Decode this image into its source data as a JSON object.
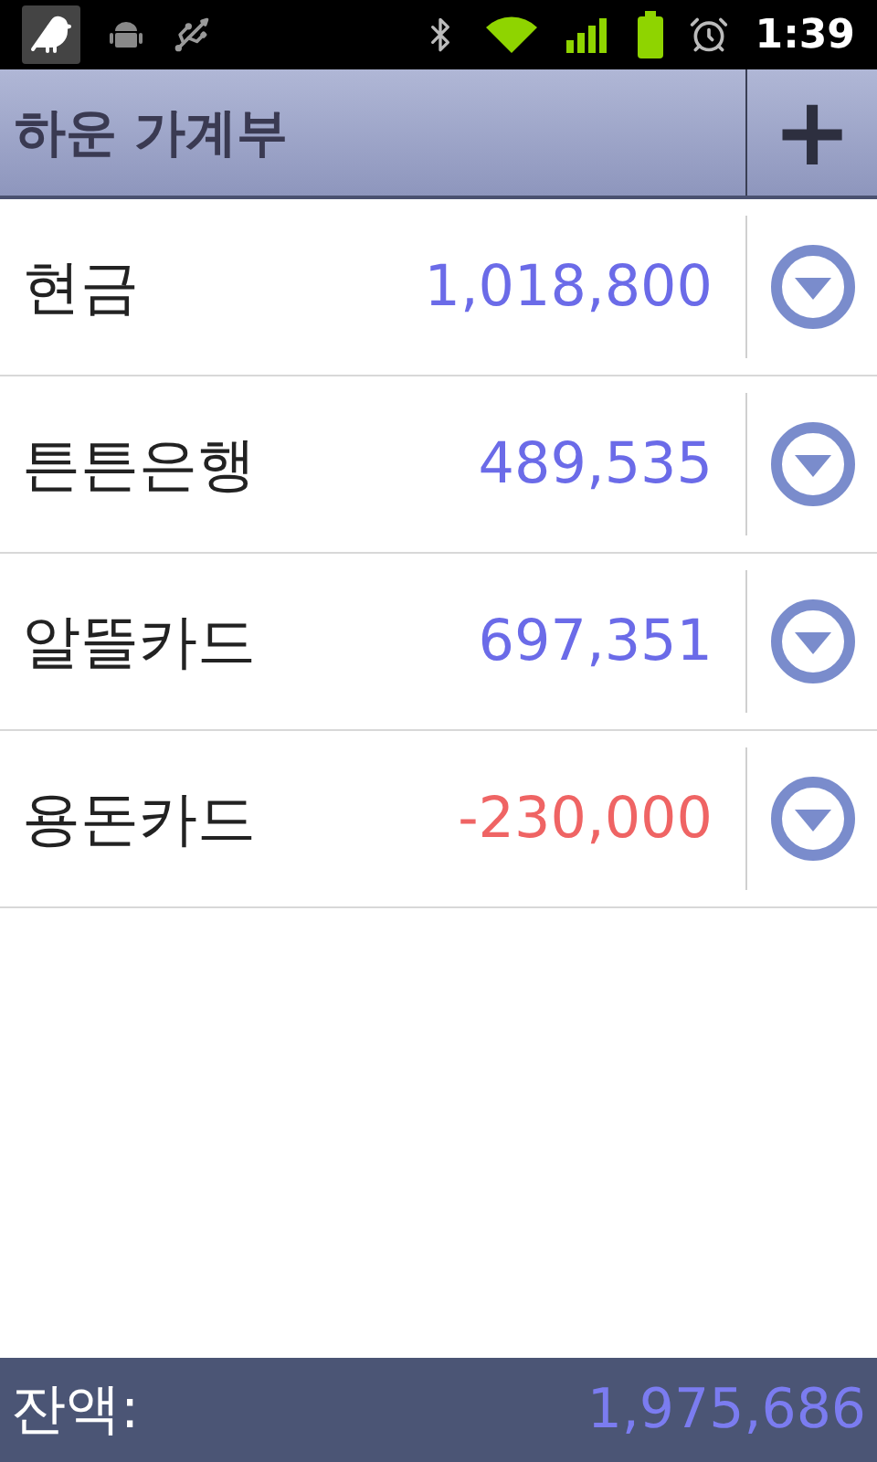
{
  "status_bar": {
    "time": "1:39"
  },
  "title_bar": {
    "title": "하운 가계부",
    "add_button": "+"
  },
  "accounts": [
    {
      "name": "현금",
      "amount": "1,018,800",
      "color": "#6b6be8"
    },
    {
      "name": "튼튼은행",
      "amount": "489,535",
      "color": "#6b6be8"
    },
    {
      "name": "알뜰카드",
      "amount": "697,351",
      "color": "#6b6be8"
    },
    {
      "name": "용돈카드",
      "amount": "-230,000",
      "color": "#ef6464"
    }
  ],
  "footer": {
    "label": "잔액:",
    "total": "1,975,686"
  }
}
